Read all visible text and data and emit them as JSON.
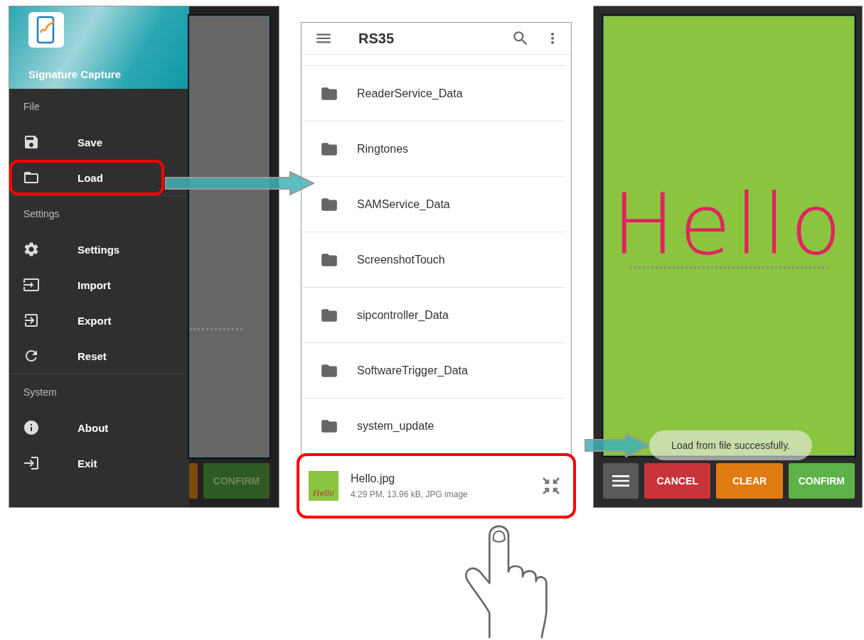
{
  "left_screen": {
    "app_title": "Signature Capture",
    "drawer_sections": [
      {
        "title": "File",
        "items": [
          {
            "label": "Save",
            "highlighted": false
          },
          {
            "label": "Load",
            "highlighted": true
          }
        ]
      },
      {
        "title": "Settings",
        "items": [
          {
            "label": "Settings",
            "highlighted": false
          },
          {
            "label": "Import",
            "highlighted": false
          },
          {
            "label": "Export",
            "highlighted": false
          },
          {
            "label": "Reset",
            "highlighted": false
          }
        ]
      },
      {
        "title": "System",
        "items": [
          {
            "label": "About",
            "highlighted": false
          },
          {
            "label": "Exit",
            "highlighted": false
          }
        ]
      }
    ],
    "confirm_label": "CONFIRM"
  },
  "file_picker": {
    "title": "RS35",
    "folders": [
      "ReaderService_Data",
      "Ringtones",
      "SAMService_Data",
      "ScreenshotTouch",
      "sipcontroller_Data",
      "SoftwareTrigger_Data",
      "system_update"
    ],
    "file": {
      "name": "Hello.jpg",
      "details": "4:29 PM, 13.96 kB, JPG image",
      "thumbnail_text": "Hello",
      "highlighted": true
    }
  },
  "right_screen": {
    "signature": "Hello",
    "buttons": [
      {
        "label": "CANCEL",
        "color": "#c8343a"
      },
      {
        "label": "CLEAR",
        "color": "#e07b14"
      },
      {
        "label": "CONFIRM",
        "color": "#5db347"
      }
    ],
    "toast": "Load from file successfully."
  }
}
